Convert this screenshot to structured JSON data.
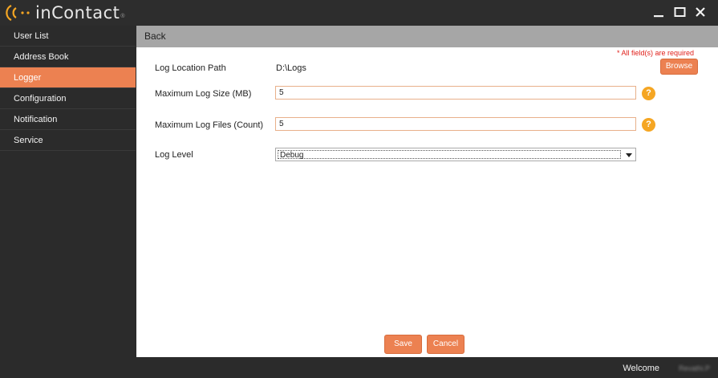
{
  "app": {
    "brand": "inContact",
    "brand_tm": "®"
  },
  "window_controls": {
    "minimize_icon": "minimize-icon",
    "maximize_icon": "maximize-icon",
    "close_icon": "close-icon"
  },
  "sidebar": {
    "items": [
      {
        "label": "User List",
        "active": false
      },
      {
        "label": "Address Book",
        "active": false
      },
      {
        "label": "Logger",
        "active": true
      },
      {
        "label": "Configuration",
        "active": false
      },
      {
        "label": "Notification",
        "active": false
      },
      {
        "label": "Service",
        "active": false
      }
    ]
  },
  "header": {
    "back_label": "Back"
  },
  "form": {
    "required_note": "* All field(s) are required",
    "log_location": {
      "label": "Log Location Path",
      "value": "D:\\Logs",
      "browse_label": "Browse"
    },
    "max_log_size": {
      "label": "Maximum Log Size (MB)",
      "value": "5"
    },
    "max_log_files": {
      "label": "Maximum Log Files (Count)",
      "value": "5"
    },
    "log_level": {
      "label": "Log Level",
      "selected": "Debug"
    },
    "help_glyph": "?"
  },
  "actions": {
    "save_label": "Save",
    "cancel_label": "Cancel"
  },
  "status": {
    "welcome_label": "Welcome",
    "username": "Revathi.P"
  },
  "colors": {
    "accent": "#ec8151",
    "sidebar_bg": "#2b2b2b",
    "header_bar": "#a6a6a6",
    "required": "#e0201b",
    "help": "#f5a623"
  }
}
